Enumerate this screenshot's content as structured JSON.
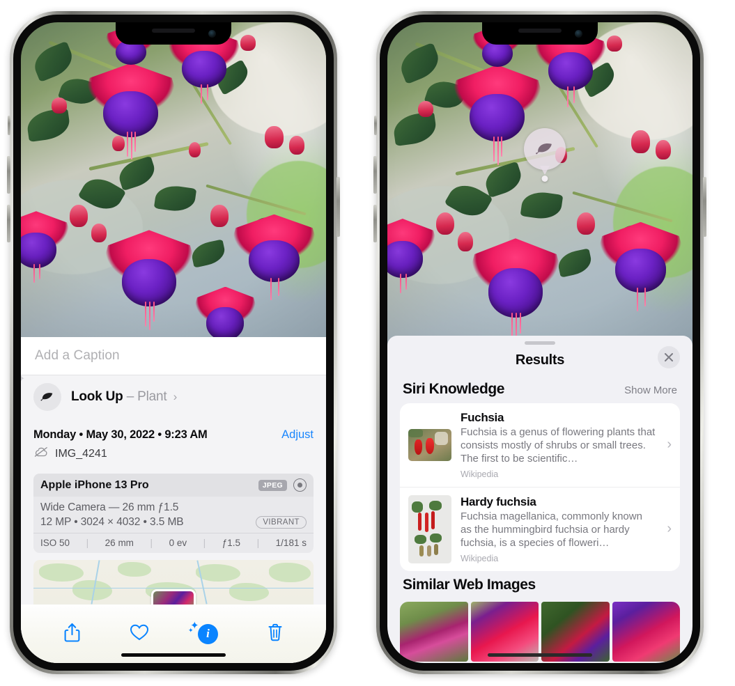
{
  "left_phone": {
    "caption_placeholder": "Add a Caption",
    "lookup": {
      "label": "Look Up",
      "dash": "–",
      "subject": "Plant",
      "chevron": "›",
      "icon": "leaf-icon"
    },
    "meta": {
      "date_line": "Monday • May 30, 2022 • 9:23 AM",
      "adjust_label": "Adjust",
      "filename": "IMG_4241",
      "cloud_icon": "cloud-slash-icon"
    },
    "exif": {
      "device": "Apple iPhone 13 Pro",
      "format_tag": "JPEG",
      "raw_icon": "raw-target-icon",
      "lens_line": "Wide Camera — 26 mm ƒ1.5",
      "size_line": "12 MP • 3024 × 4032 • 3.5 MB",
      "style_tag": "VIBRANT",
      "stats": [
        "ISO 50",
        "26 mm",
        "0 ev",
        "ƒ1.5",
        "1/181 s"
      ]
    },
    "toolbar": [
      {
        "name": "share-button",
        "icon": "share-icon"
      },
      {
        "name": "favorite-button",
        "icon": "heart-icon"
      },
      {
        "name": "info-button",
        "icon": "info-sparkle-icon"
      },
      {
        "name": "delete-button",
        "icon": "trash-icon"
      }
    ]
  },
  "right_phone": {
    "visual_lookup_pin": "leaf-icon",
    "sheet": {
      "title": "Results",
      "close_label": "✕",
      "grabber": "drag-handle"
    },
    "siri_knowledge": {
      "title": "Siri Knowledge",
      "show_more": "Show More",
      "items": [
        {
          "title": "Fuchsia",
          "description": "Fuchsia is a genus of flowering plants that consists mostly of shrubs or small trees. The first to be scientific…",
          "source": "Wikipedia",
          "chevron": "›"
        },
        {
          "title": "Hardy fuchsia",
          "description": "Fuchsia magellanica, commonly known as the hummingbird fuchsia or hardy fuchsia, is a species of floweri…",
          "source": "Wikipedia",
          "chevron": "›"
        }
      ]
    },
    "similar_web_images": {
      "title": "Similar Web Images",
      "count": 4
    }
  },
  "colors": {
    "accent_blue": "#0a84ff",
    "link_blue": "#1a86fd",
    "sheet_bg": "#f1f1f5",
    "card_bg": "#ffffff",
    "muted_text": "#78787f"
  }
}
